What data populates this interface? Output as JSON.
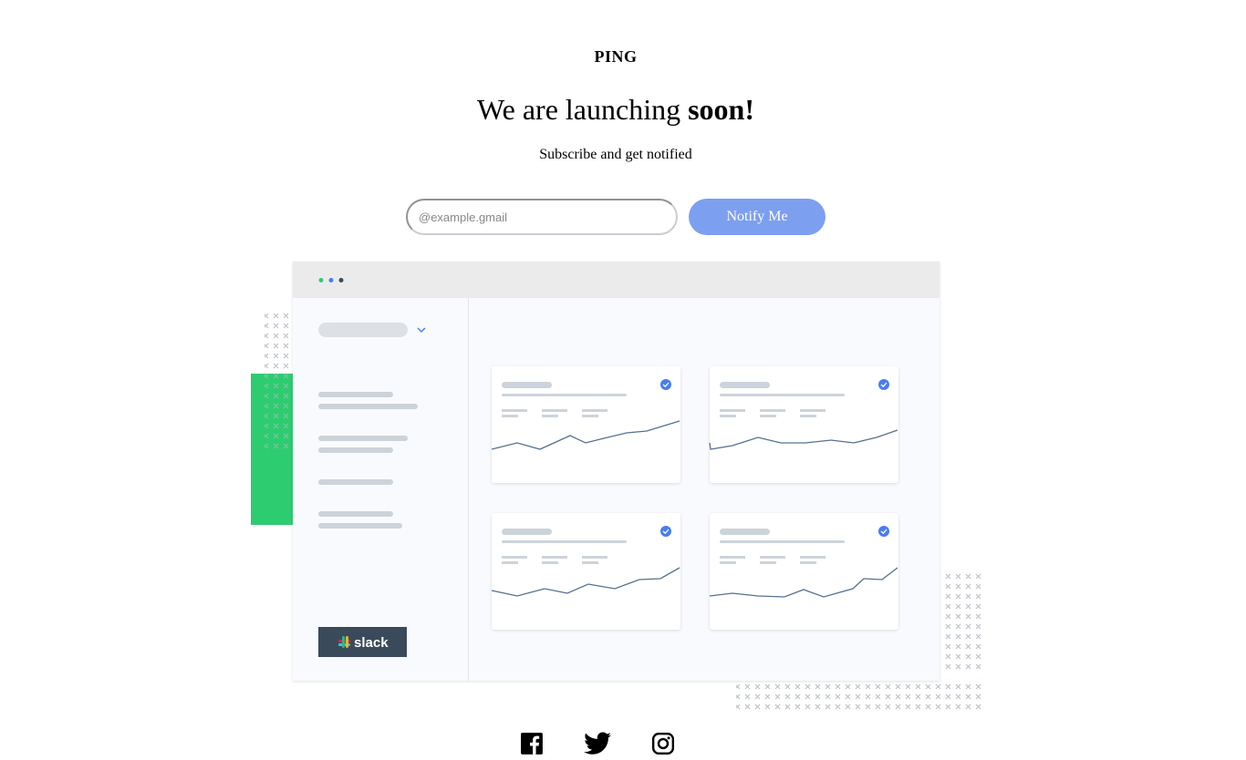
{
  "brand": "PING",
  "headline": {
    "prefix": "We are launching ",
    "emphasis": "soon!"
  },
  "subtitle": "Subscribe and get notified",
  "form": {
    "email_placeholder": "@example.gmail",
    "email_value": "",
    "button_label": "Notify Me"
  },
  "illustration": {
    "window_dot_colors": [
      "#2ecc71",
      "#4a7cf0",
      "#3a4a5a"
    ],
    "accent_color": "#2ecc71",
    "card_check_color": "#4a7cf0",
    "slack_label": "slack"
  },
  "social": [
    {
      "name": "facebook",
      "icon": "facebook-icon"
    },
    {
      "name": "twitter",
      "icon": "twitter-icon"
    },
    {
      "name": "instagram",
      "icon": "instagram-icon"
    }
  ]
}
